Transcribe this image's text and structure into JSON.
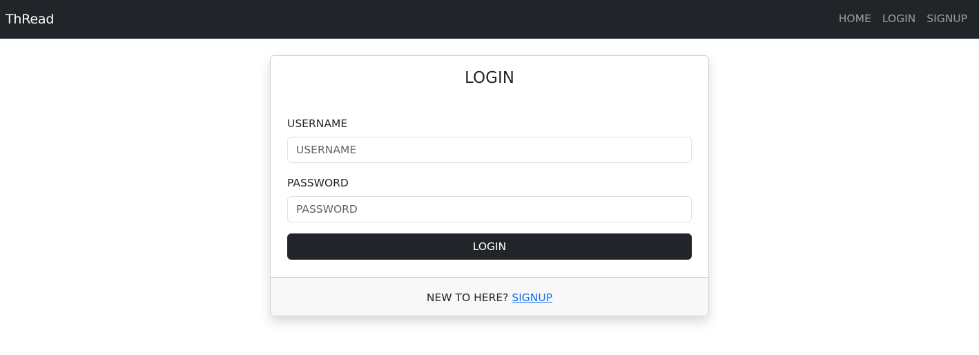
{
  "navbar": {
    "brand": "ThRead",
    "links": [
      "HOME",
      "LOGIN",
      "SIGNUP"
    ]
  },
  "login_card": {
    "title": "LOGIN",
    "username": {
      "label": "USERNAME",
      "placeholder": "USERNAME",
      "value": ""
    },
    "password": {
      "label": "PASSWORD",
      "placeholder": "PASSWORD",
      "value": ""
    },
    "submit_label": "LOGIN",
    "footer": {
      "prompt": "NEW TO HERE?",
      "link_label": "SIGNUP"
    }
  },
  "colors": {
    "navbar_bg": "#212529",
    "button_bg": "#212529",
    "link": "#0d6efd",
    "footer_bg": "#f8f8f8"
  }
}
